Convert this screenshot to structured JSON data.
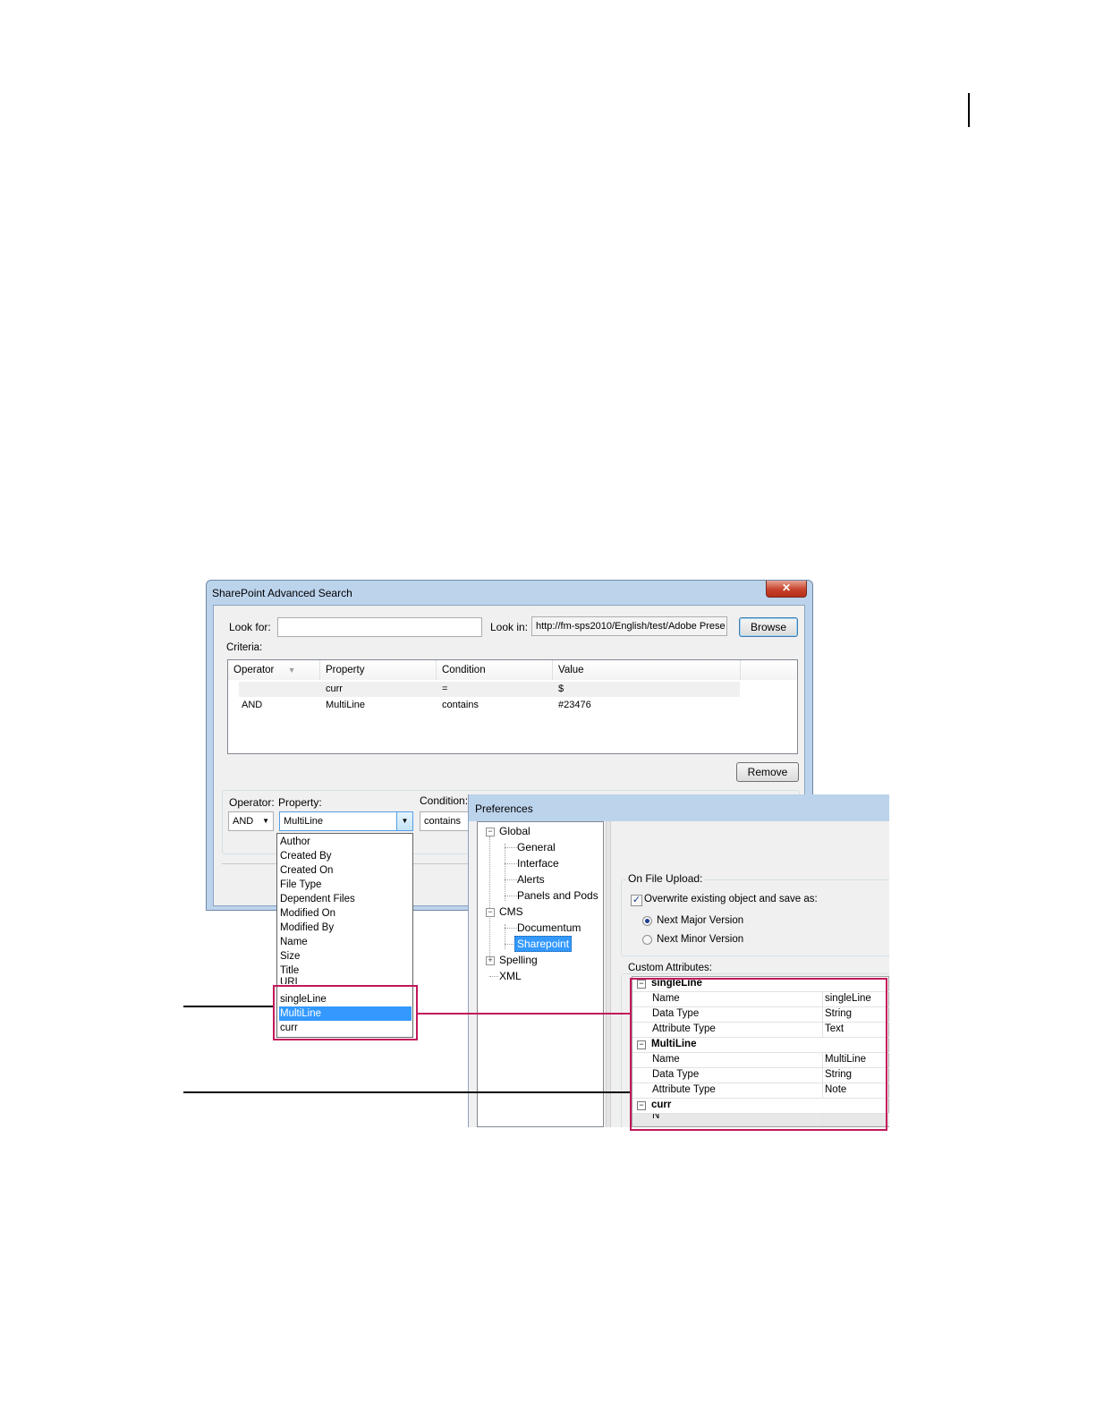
{
  "sp_dialog": {
    "title": "SharePoint Advanced Search",
    "close_glyph": "✕",
    "look_for_label": "Look for:",
    "look_for_value": "",
    "look_in_label": "Look in:",
    "look_in_value": "http://fm-sps2010/English/test/Adobe Prese",
    "browse_label": "Browse",
    "criteria_label": "Criteria:",
    "columns": [
      "Operator",
      "Property",
      "Condition",
      "Value"
    ],
    "rows": [
      {
        "operator": "",
        "property": "curr",
        "condition": "=",
        "value": "$"
      },
      {
        "operator": "AND",
        "property": "MultiLine",
        "condition": "contains",
        "value": "#23476"
      }
    ],
    "remove_label": "Remove",
    "operator_label": "Operator:",
    "property_label": "Property:",
    "condition_label": "Condition:",
    "operator_value": "AND",
    "property_value": "MultiLine",
    "condition_value": "contains",
    "property_options": [
      "Author",
      "Created By",
      "Created On",
      "File Type",
      "Dependent Files",
      "Modified On",
      "Modified By",
      "Name",
      "Size",
      "Title",
      "URL",
      "singleLine",
      "MultiLine",
      "curr"
    ],
    "selected_option": "MultiLine"
  },
  "preferences": {
    "title": "Preferences",
    "tree": {
      "global": "Global",
      "general": "General",
      "interface": "Interface",
      "alerts": "Alerts",
      "panels": "Panels and Pods",
      "cms": "CMS",
      "documentum": "Documentum",
      "sharepoint": "Sharepoint",
      "spelling": "Spelling",
      "xml": "XML"
    },
    "on_file_upload_label": "On File Upload:",
    "overwrite_label": "Overwrite existing object and save as:",
    "overwrite_checked": true,
    "next_major_label": "Next Major Version",
    "next_minor_label": "Next Minor Version",
    "selected_version": "Next Major Version",
    "custom_attributes_label": "Custom Attributes:",
    "attributes": [
      {
        "name": "singleLine",
        "props": [
          [
            "Name",
            "singleLine"
          ],
          [
            "Data Type",
            "String"
          ],
          [
            "Attribute Type",
            "Text"
          ]
        ]
      },
      {
        "name": "MultiLine",
        "props": [
          [
            "Name",
            "MultiLine"
          ],
          [
            "Data Type",
            "String"
          ],
          [
            "Attribute Type",
            "Note"
          ]
        ]
      },
      {
        "name": "curr",
        "props": [
          [
            "N",
            ""
          ]
        ]
      }
    ]
  },
  "colors": {
    "highlight": "#3399ff",
    "callout": "#c2185b"
  }
}
